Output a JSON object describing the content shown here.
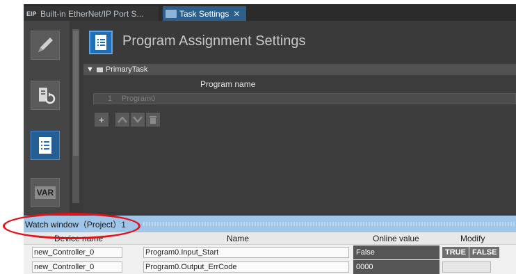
{
  "tabs": [
    {
      "label": "Built-in EtherNet/IP Port S...",
      "icon": "network-port-icon",
      "icon_text": "EIP"
    },
    {
      "label": "Task Settings",
      "icon": "task-settings-icon",
      "close": "✕"
    }
  ],
  "rail": {
    "var_label": "VAR"
  },
  "header": {
    "title": "Program Assignment Settings"
  },
  "task": {
    "name": "PrimaryTask",
    "column_header": "Program name",
    "programs": [
      {
        "num": "1",
        "name": "Program0"
      }
    ]
  },
  "watch": {
    "title": "Watch window（Project）1",
    "columns": [
      "Device name",
      "Name",
      "Online value",
      "Modify"
    ],
    "rows": [
      {
        "device": "new_Controller_0",
        "name": "Program0.Input_Start",
        "value": "False",
        "modify": [
          "TRUE",
          "FALSE"
        ]
      },
      {
        "device": "new_Controller_0",
        "name": "Program0.Output_ErrCode",
        "value": "0000",
        "modify": []
      }
    ]
  },
  "colors": {
    "accent": "#235f94",
    "annotation": "#e0121a",
    "watch_bar": "#9fc5e8"
  }
}
